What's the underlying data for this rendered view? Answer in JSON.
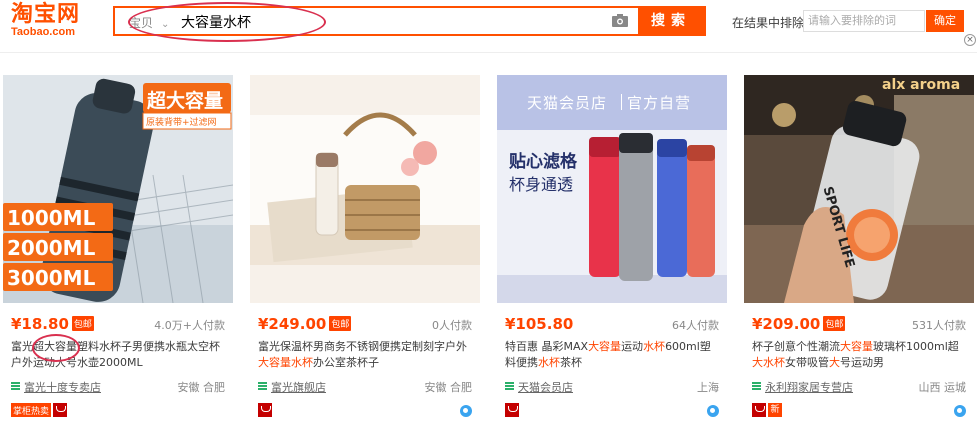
{
  "header": {
    "logo_cn": "淘宝网",
    "logo_en": "Taobao.com",
    "search_type": "宝贝",
    "search_query": "大容量水杯",
    "search_button": "搜索",
    "exclude_label": "在结果中排除",
    "exclude_placeholder": "请输入要排除的词",
    "confirm_button": "确定",
    "close_symbol": "×"
  },
  "colors": {
    "accent": "#ff5000",
    "price": "#ff4400",
    "annotation_circle": "#d9304f",
    "tmall_red": "#c40000"
  },
  "products": [
    {
      "image_texts": {
        "banner": "超大容量",
        "sub": "原装背带+过滤网",
        "v1": "1000ML",
        "v2": "2000ML",
        "v3": "3000ML"
      },
      "price": "¥18.80",
      "baoyou": "包邮",
      "sales": "4.0万+人付款",
      "title_parts": [
        {
          "t": "富光"
        },
        {
          "t": "超大容量",
          "hl": false
        },
        {
          "t": "塑料水杯子男便携水瓶太空杯户外运动大号水壶2000ML"
        }
      ],
      "shop": "富光十度专卖店",
      "location": "安徽 合肥",
      "badges": {
        "hot": "掌柜热卖",
        "tmall": true,
        "new": ""
      }
    },
    {
      "image_texts": {},
      "price": "¥249.00",
      "baoyou": "包邮",
      "sales": "0人付款",
      "title_parts": [
        {
          "t": "富光保温杯男商务不锈钢便携定制刻字户外"
        },
        {
          "t": "大容量水杯",
          "hl": true
        },
        {
          "t": "办公室茶杯子"
        }
      ],
      "shop": "富光旗舰店",
      "location": "安徽 合肥",
      "badges": {
        "hot": "",
        "tmall": true,
        "new": ""
      }
    },
    {
      "image_texts": {
        "head1": "天猫会员店",
        "head2": "官方自营",
        "tag1": "贴心滤格",
        "tag2": "杯身通透"
      },
      "price": "¥105.80",
      "baoyou": "",
      "sales": "64人付款",
      "title_parts": [
        {
          "t": "特百惠 晶彩MAX"
        },
        {
          "t": "大容量",
          "hl": true
        },
        {
          "t": "运动"
        },
        {
          "t": "水杯",
          "hl": true
        },
        {
          "t": "600ml塑料便携"
        },
        {
          "t": "水杯",
          "hl": true
        },
        {
          "t": "茶杯"
        }
      ],
      "shop": "天猫会员店",
      "location": "上海",
      "badges": {
        "hot": "",
        "tmall": true,
        "new": ""
      }
    },
    {
      "image_texts": {
        "bottle": "SPORT LIFE",
        "sign": "alx aroma"
      },
      "price": "¥209.00",
      "baoyou": "包邮",
      "sales": "531人付款",
      "title_parts": [
        {
          "t": "杯子创意个性潮流"
        },
        {
          "t": "大容量",
          "hl": true
        },
        {
          "t": "玻璃杯1000ml超"
        },
        {
          "t": "大水杯",
          "hl": true
        },
        {
          "t": "女带吸管"
        },
        {
          "t": "大",
          "hl": true
        },
        {
          "t": "号运动男"
        }
      ],
      "shop": "永利翔家居专营店",
      "location": "山西 运城",
      "badges": {
        "hot": "",
        "tmall": true,
        "new": "新"
      }
    }
  ]
}
